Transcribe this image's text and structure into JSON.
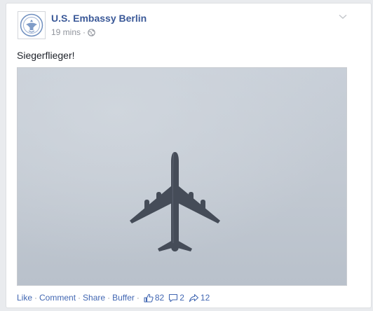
{
  "post": {
    "page_name": "U.S. Embassy Berlin",
    "timestamp": "19 mins",
    "meta_separator": "·",
    "privacy_icon": "globe-icon",
    "options_icon": "chevron-down-icon",
    "text": "Siegerflieger!",
    "photo_subject": "airplane-photo"
  },
  "actions": {
    "like": "Like",
    "comment": "Comment",
    "share": "Share",
    "buffer": "Buffer",
    "separator": "·"
  },
  "stats": {
    "likes": "82",
    "comments": "2",
    "shares": "12"
  },
  "colors": {
    "link": "#3b5998",
    "action": "#4267b2",
    "muted": "#90949c",
    "sky": "#c7cfd8"
  }
}
